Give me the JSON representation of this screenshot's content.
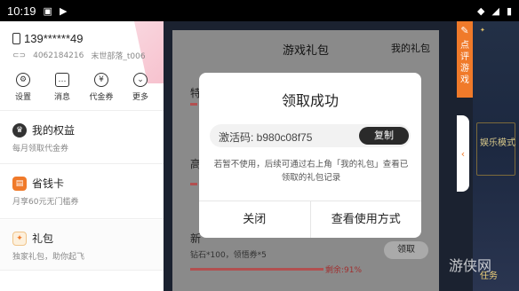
{
  "status_bar": {
    "time": "10:19"
  },
  "sidebar": {
    "phone": "139******49",
    "user_id": "4062184216",
    "tribe": "末世部落_t006",
    "quick_actions": [
      {
        "label": "设置",
        "icon": "gear-icon"
      },
      {
        "label": "消息",
        "icon": "message-icon"
      },
      {
        "label": "代金券",
        "icon": "coupon-icon"
      },
      {
        "label": "更多",
        "icon": "more-icon"
      }
    ],
    "items": [
      {
        "title": "我的权益",
        "sub": "每月领取代金券",
        "icon": "crown-icon"
      },
      {
        "title": "省钱卡",
        "sub": "月享60元无门槛券",
        "icon": "card-icon"
      },
      {
        "title": "礼包",
        "sub": "独家礼包，助你起飞",
        "icon": "gift-icon"
      }
    ]
  },
  "panel": {
    "title": "游戏礼包",
    "my_gifts": "我的礼包",
    "rows": [
      {
        "name": "特"
      },
      {
        "name": "高"
      },
      {
        "name": "新"
      }
    ],
    "bottom_desc": "钻石*100，领悟券*5",
    "remaining": "剩余:91%",
    "claim_label": "领取"
  },
  "dialog": {
    "title": "领取成功",
    "code": "激活码: b980c08f75",
    "copy_label": "复制",
    "note": "若暂不使用，后续可通过右上角「我的礼包」查看已领取的礼包记录",
    "close_label": "关闭",
    "view_label": "查看使用方式"
  },
  "right_tab": {
    "label": "点评游戏"
  },
  "game_bg": {
    "mode": "娱乐模式",
    "task": "任务",
    "watermark": "游侠网"
  }
}
